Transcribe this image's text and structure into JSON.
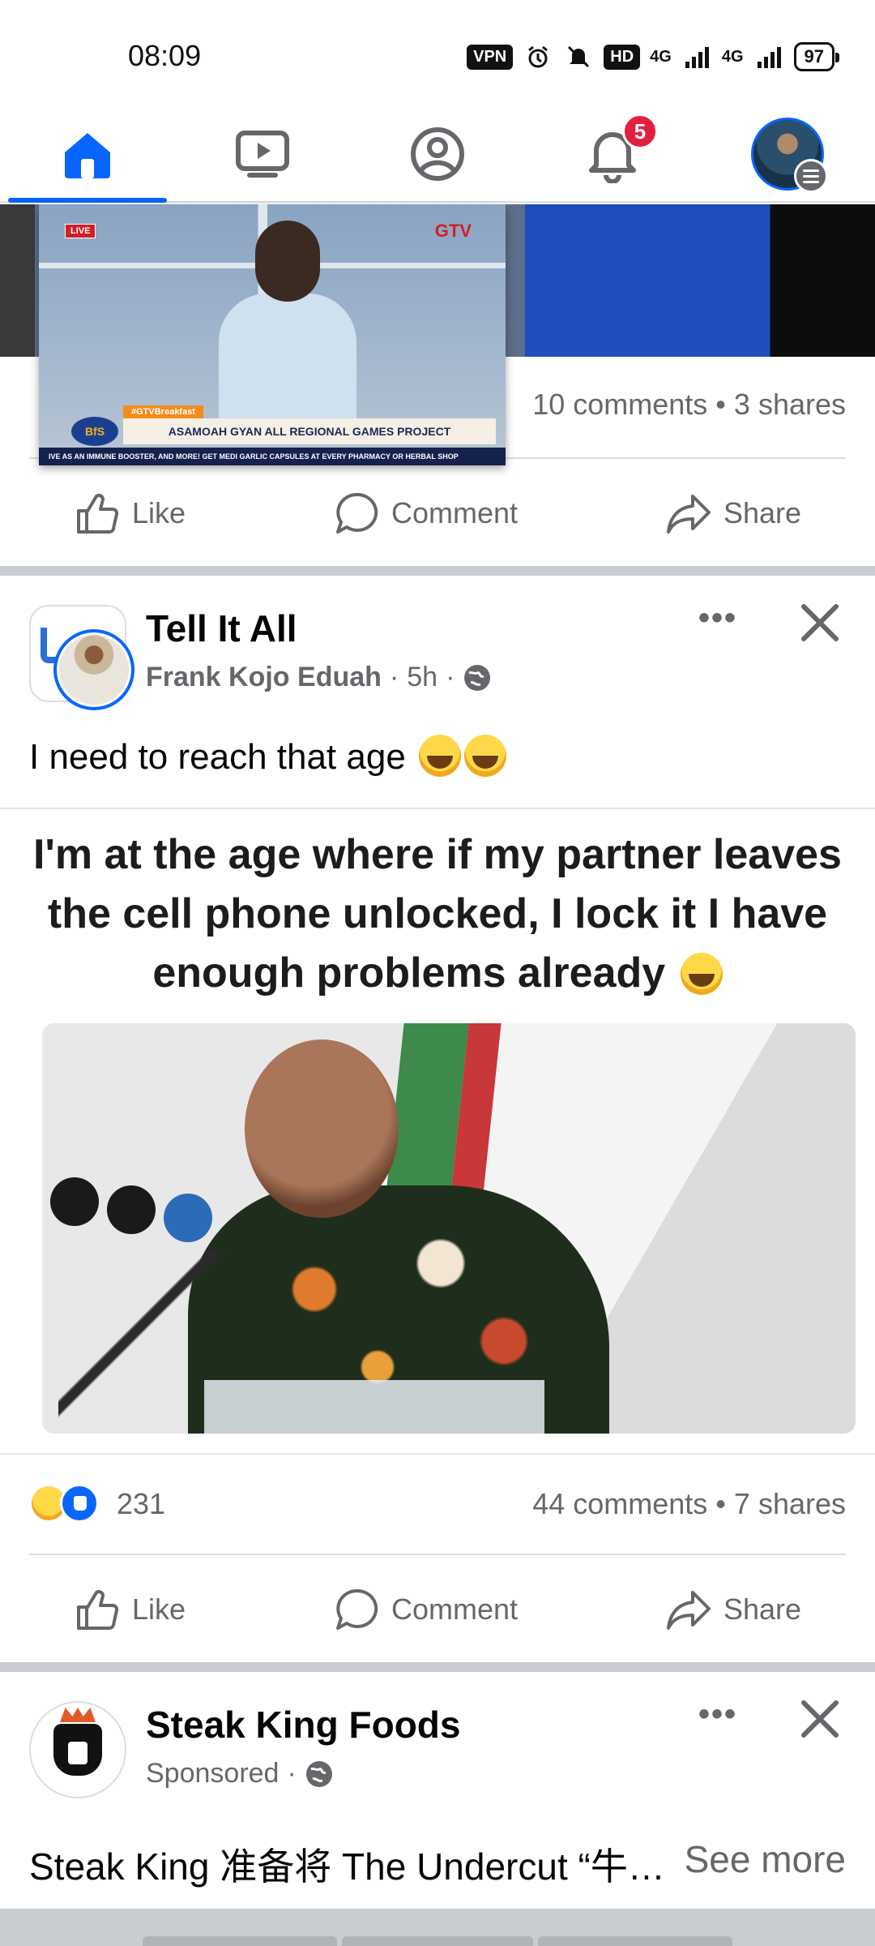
{
  "status_bar": {
    "time": "08:09",
    "vpn": "VPN",
    "hd": "HD",
    "signal1": "4G",
    "signal2": "4G",
    "battery": "97"
  },
  "nav": {
    "notifications_badge": "5"
  },
  "previous_post": {
    "stats": "10 comments • 3 shares",
    "like": "Like",
    "comment": "Comment",
    "share": "Share"
  },
  "mini_player": {
    "live": "LIVE",
    "channel_logo": "GTV",
    "tag": "#GTVBreakfast",
    "show_logo": "BfS",
    "lower_third": "ASAMOAH GYAN ALL REGIONAL GAMES PROJECT",
    "ticker": "IVE AS AN IMMUNE BOOSTER, AND MORE! GET MEDI GARLIC CAPSULES AT EVERY PHARMACY OR HERBAL SHOP"
  },
  "post": {
    "page_name": "Tell It All",
    "author": "Frank Kojo Eduah",
    "time": "5h",
    "text": "I need to reach that age",
    "more": "•••",
    "meme_caption": "I'm at the age where if my partner leaves the cell phone unlocked, I lock it I have enough problems already",
    "reactions_count": "231",
    "stats": "44 comments • 7 shares",
    "like": "Like",
    "comment": "Comment",
    "share": "Share"
  },
  "sponsored": {
    "name": "Steak King Foods",
    "label": "Sponsored",
    "more": "•••",
    "text": "Steak King 准备将 The Undercut “牛…",
    "see_more": "See more"
  },
  "colors": {
    "accent": "#0866ff",
    "badge": "#e41e3f",
    "secondary_text": "#65676b"
  }
}
